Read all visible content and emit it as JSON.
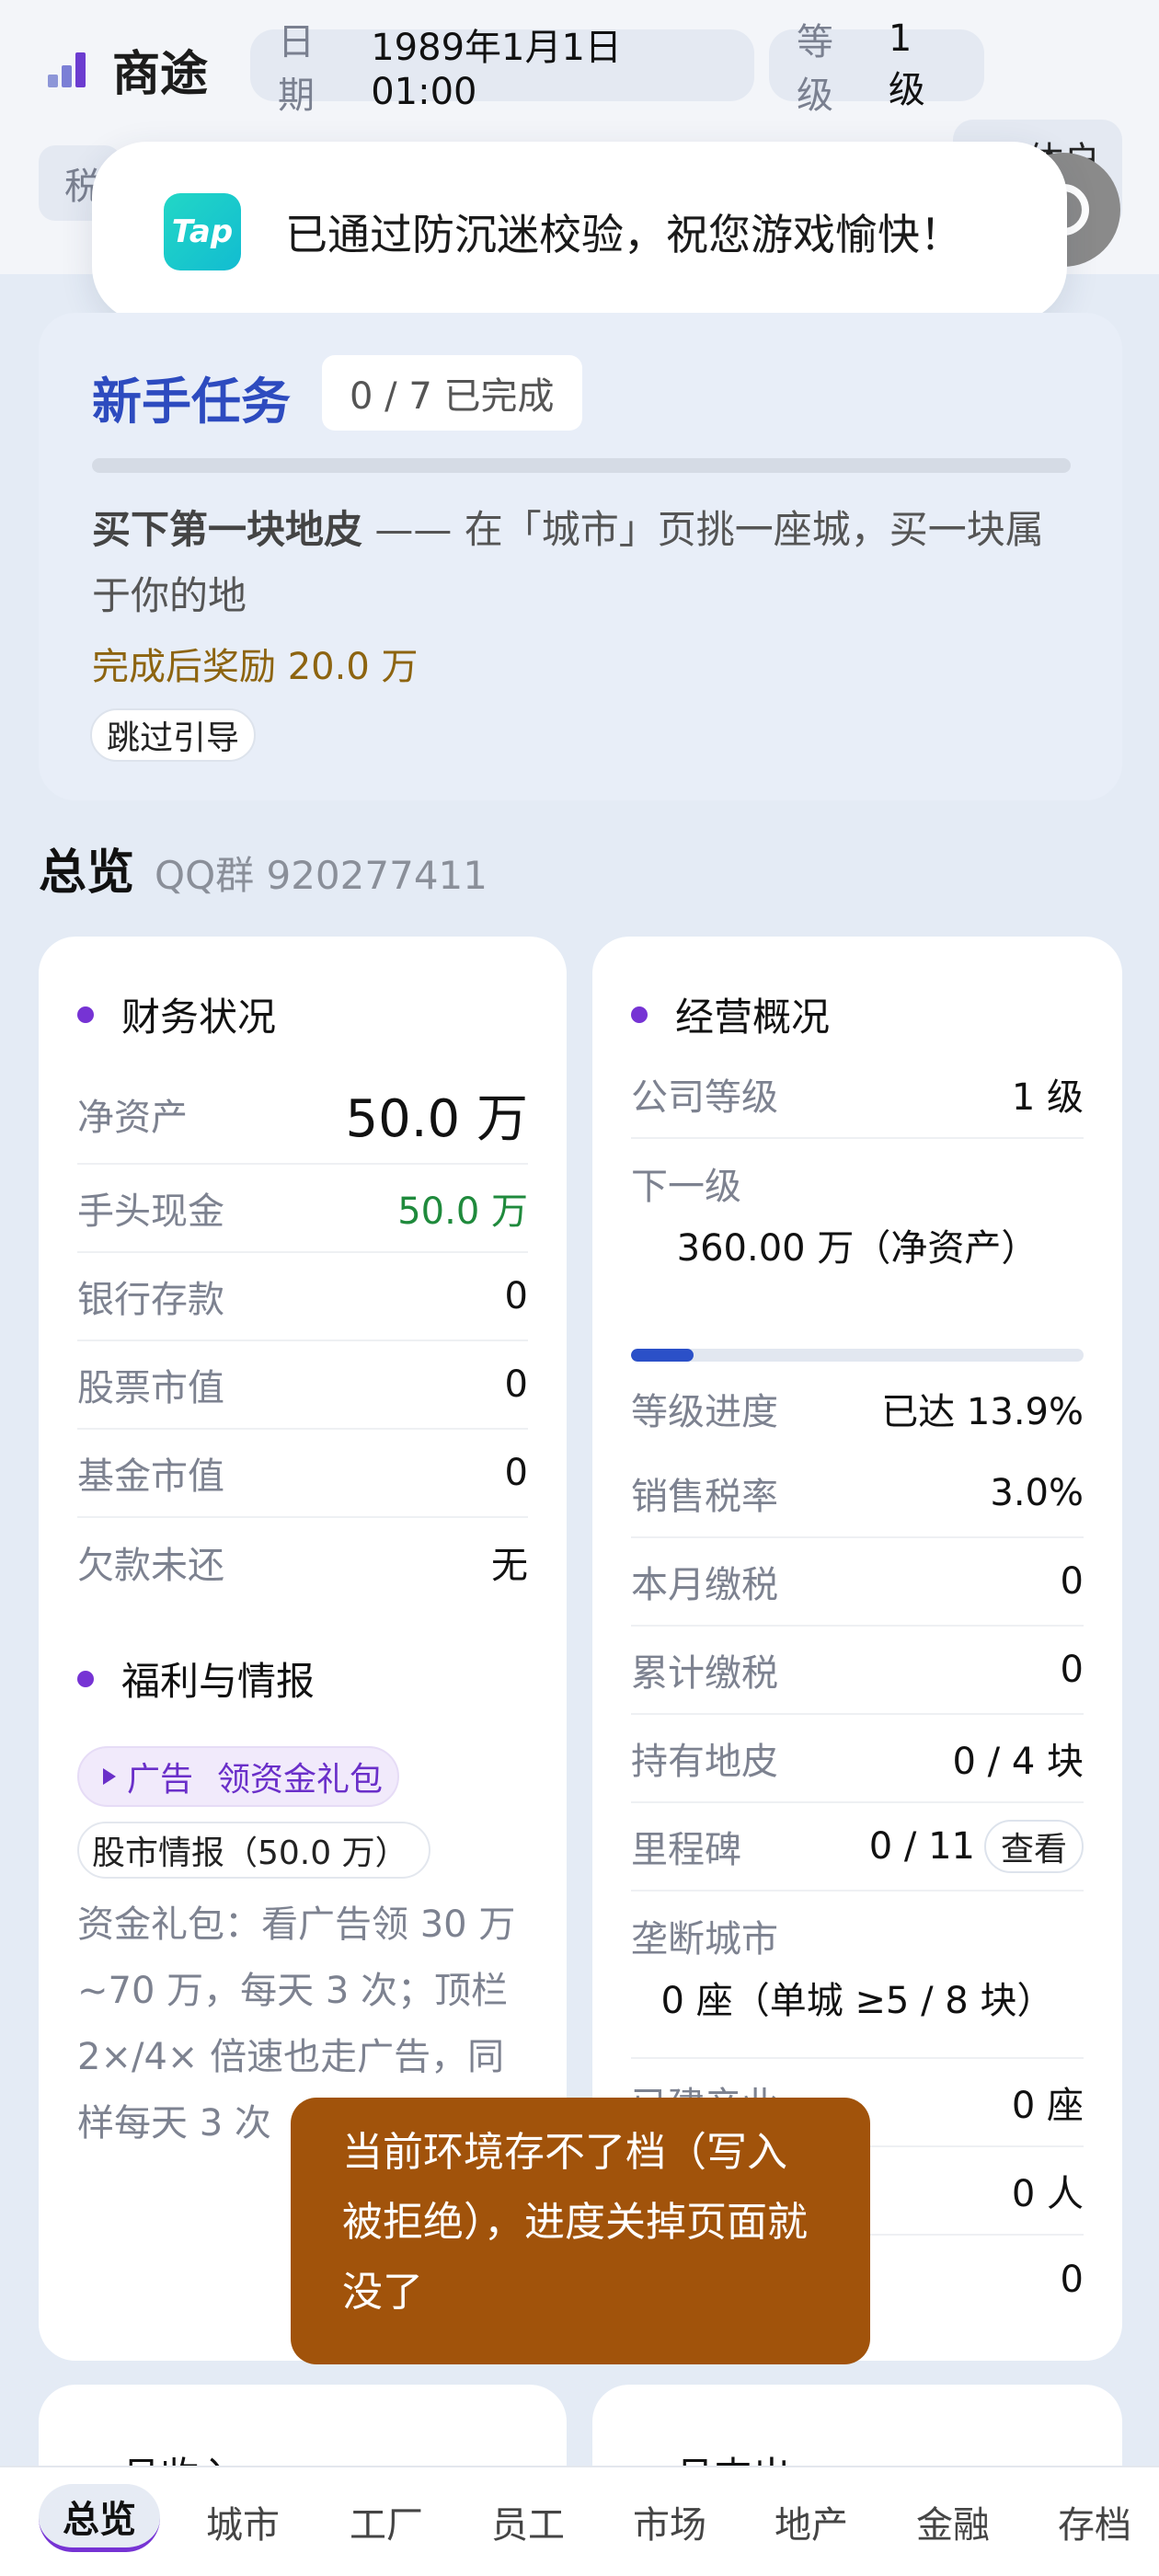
{
  "header": {
    "app_title": "商途",
    "date_label": "日期",
    "date_value": "1989年1月1日 01:00",
    "level_label": "等级",
    "level_value": "1 级",
    "tax_short": "税",
    "account_label": "个体户"
  },
  "toast": {
    "logo_text": "Tap",
    "message": "已通过防沉迷校验，祝您游戏愉快！"
  },
  "tasks": {
    "title": "新手任务",
    "count": "0 / 7 已完成",
    "progress": 0,
    "task_name": "买下第一块地皮",
    "task_detail": " —— 在「城市」页挑一座城，买一块属于你的地",
    "reward": "完成后奖励 20.0 万",
    "skip_label": "跳过引导"
  },
  "overview": {
    "title": "总览",
    "subtitle": "QQ群 920277411"
  },
  "finance": {
    "title": "财务状况",
    "rows": [
      {
        "label": "净资产",
        "value": "50.0 万"
      },
      {
        "label": "手头现金",
        "value": "50.0 万"
      },
      {
        "label": "银行存款",
        "value": "0"
      },
      {
        "label": "股票市值",
        "value": "0"
      },
      {
        "label": "基金市值",
        "value": "0"
      },
      {
        "label": "欠款未还",
        "value": "无"
      }
    ],
    "cash_color": "#1f8a3c"
  },
  "welfare": {
    "title": "福利与情报",
    "ad_tag": "广告",
    "ad_label": "领资金礼包",
    "stock_tip": "股市情报（50.0 万）",
    "description": "资金礼包：看广告领 30 万~70 万，每天 3 次；顶栏 2×/4× 倍速也走广告，同样每天 3 次"
  },
  "operations": {
    "title": "经营概况",
    "company_level_label": "公司等级",
    "company_level_value": "1 级",
    "next_level_label": "下一级",
    "next_level_value": "360.00 万（净资产）",
    "level_progress_fraction": 0.139,
    "level_progress_label": "等级进度",
    "level_progress_value": "已达 13.9%",
    "sales_tax_label": "销售税率",
    "sales_tax_value": "3.0%",
    "month_tax_label": "本月缴税",
    "month_tax_value": "0",
    "total_tax_label": "累计缴税",
    "total_tax_value": "0",
    "land_label": "持有地皮",
    "land_value": "0 / 4 块",
    "milestone_label": "里程碑",
    "milestone_value": "0 / 11",
    "milestone_button": "查看",
    "monopoly_label": "垄断城市",
    "monopoly_value": "0 座（单城 ≥5 / 8 块）",
    "industry_label": "已建产业",
    "industry_value": "0 座",
    "employees_value": "0 人",
    "last_value": "0"
  },
  "monthly": {
    "income_title": "月收入",
    "expense_title": "月支出"
  },
  "warning": {
    "message": "当前环境存不了档（写入被拒绝），进度关掉页面就没了"
  },
  "nav": {
    "items": [
      "总览",
      "城市",
      "工厂",
      "员工",
      "市场",
      "地产",
      "金融",
      "存档"
    ],
    "active_index": 0
  },
  "colors": {
    "accent": "#7633d4",
    "task_blue": "#2d4bbf",
    "reward": "#8d6410",
    "warning_bg": "#a1530b"
  }
}
